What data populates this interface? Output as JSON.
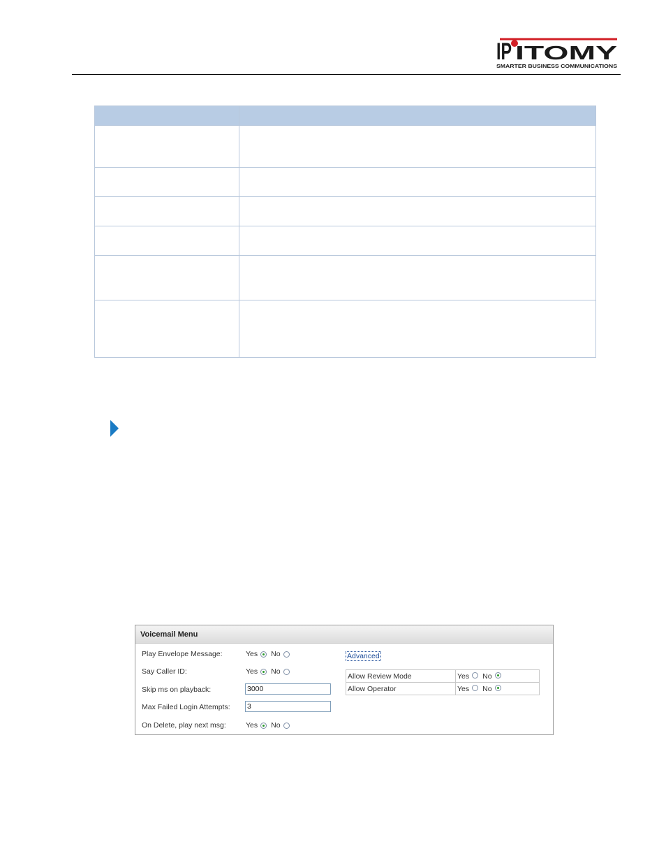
{
  "logo": {
    "brand": "IPITOMY",
    "tagline": "SMARTER BUSINESS COMMUNICATIONS",
    "accent_color": "#d21f26"
  },
  "table": {
    "header_color": "#b8cce4",
    "rows": 6
  },
  "voicemail_menu": {
    "title": "Voicemail Menu",
    "fields": [
      {
        "label": "Play Envelope Message:",
        "yes_label": "Yes",
        "no_label": "No",
        "selected": "yes"
      },
      {
        "label": "Say Caller ID:",
        "yes_label": "Yes",
        "no_label": "No",
        "selected": "yes"
      },
      {
        "label": "Skip ms on playback:",
        "value": "3000"
      },
      {
        "label": "Max Failed Login Attempts:",
        "value": "3"
      },
      {
        "label": "On Delete, play next msg:",
        "yes_label": "Yes",
        "no_label": "No",
        "selected": "yes"
      }
    ],
    "advanced": {
      "link_label": "Advanced",
      "rows": [
        {
          "label": "Allow Review Mode",
          "yes_label": "Yes",
          "no_label": "No",
          "selected": "no"
        },
        {
          "label": "Allow Operator",
          "yes_label": "Yes",
          "no_label": "No",
          "selected": "no"
        }
      ]
    }
  }
}
